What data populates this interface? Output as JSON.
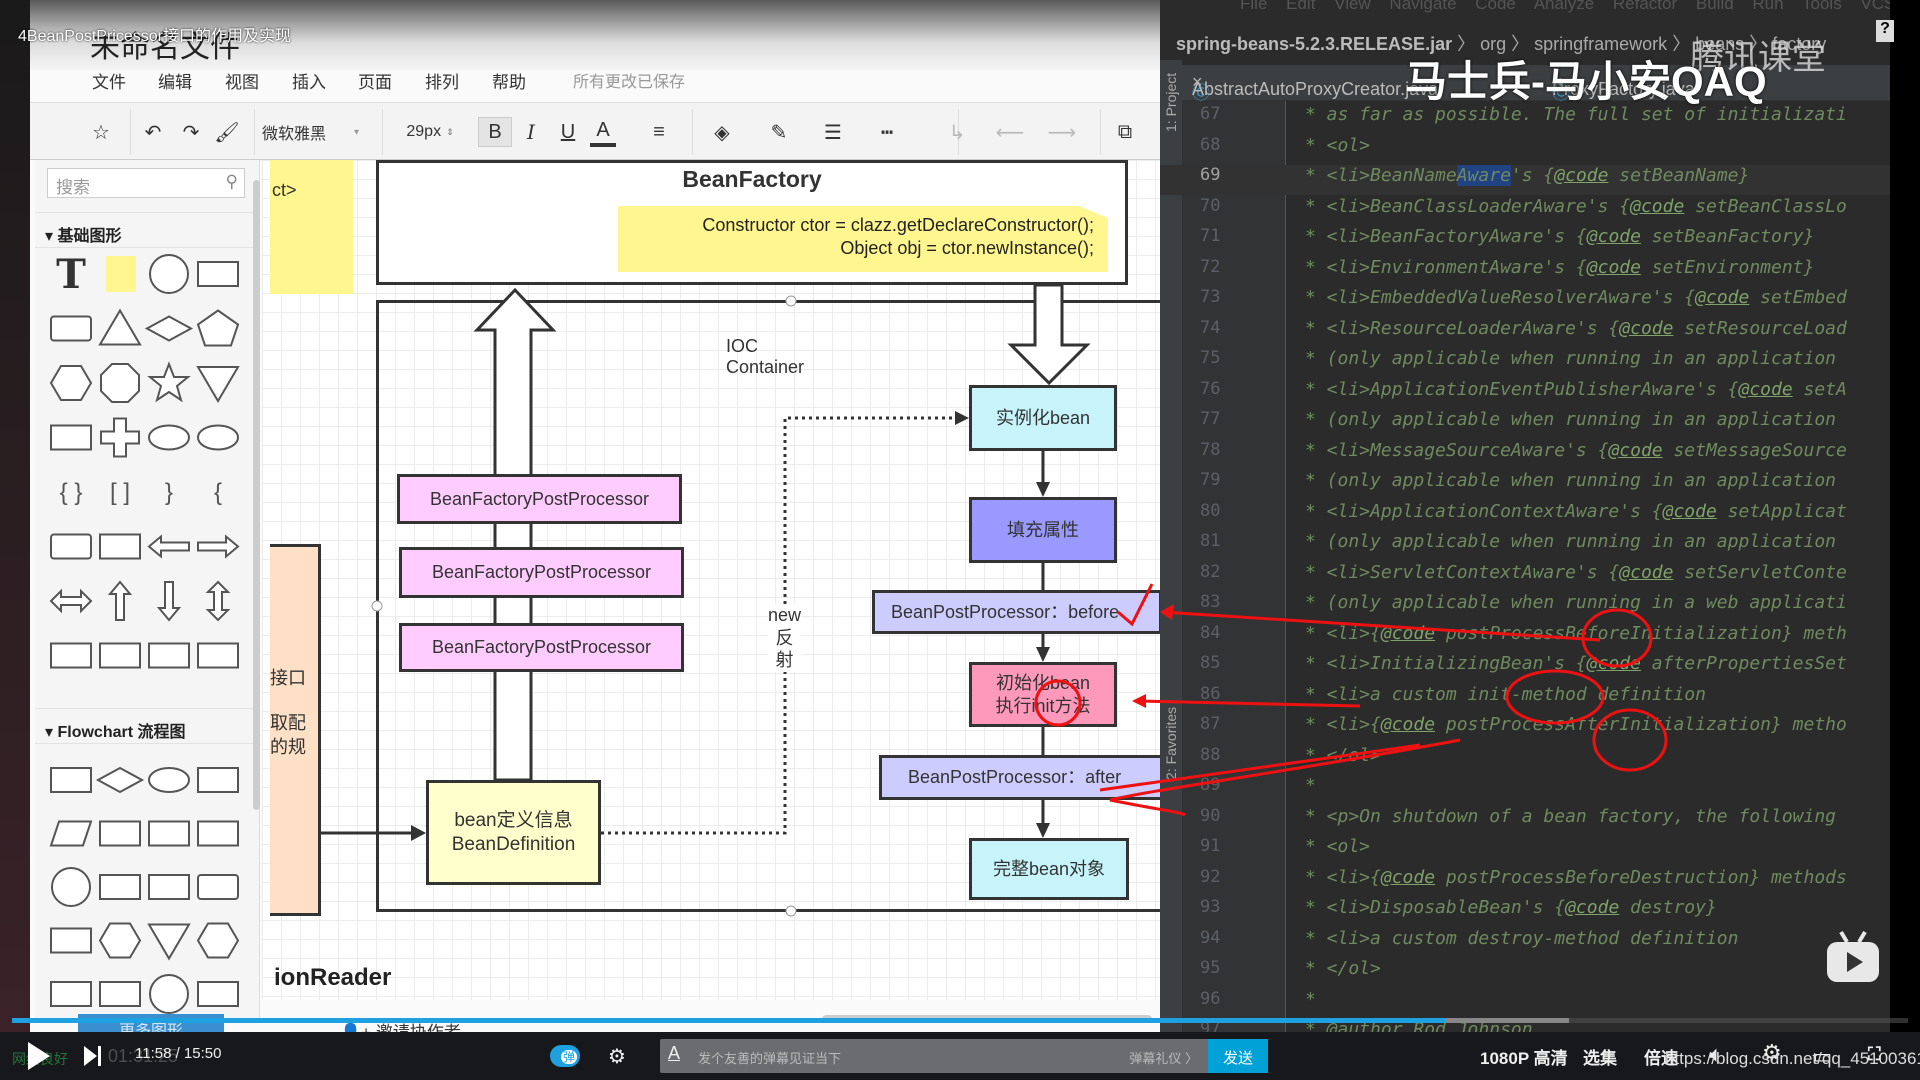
{
  "video": {
    "title": "4BeanPostPricessor接口的作用及实现",
    "watermark": "马士兵-马小安QAQ",
    "platform_mark": "腾讯课堂",
    "csdn_watermark": "https://blog.csdn.net/qq_45100361"
  },
  "editor": {
    "doc_title": "未命名文件",
    "menu": [
      "文件",
      "编辑",
      "视图",
      "插入",
      "页面",
      "排列",
      "帮助"
    ],
    "save_status": "所有更改已保存",
    "toolbar": {
      "font": "微软雅黑",
      "font_size": "29px",
      "bold": "B",
      "italic": "I",
      "underline": "U",
      "font_color": "A"
    },
    "sidebar": {
      "search_placeholder": "搜索",
      "sections": [
        {
          "title": "基础图形",
          "shapes": [
            "text",
            "note",
            "circle",
            "rect",
            "rounded-rect",
            "triangle",
            "diamond",
            "pentagon",
            "hexagon",
            "octagon",
            "star",
            "inverted-triangle",
            "banner",
            "cross",
            "cloud",
            "speech-bubble",
            "braces",
            "brackets",
            "right-brace",
            "left-brace",
            "card",
            "drop",
            "left-arrow",
            "right-arrow",
            "double-arrow",
            "up-arrow",
            "down-arrow",
            "up-down-arrow",
            "u-turn-right",
            "u-turn-left",
            "corner",
            "rect"
          ]
        },
        {
          "title": "Flowchart 流程图",
          "shapes": [
            "process",
            "decision",
            "terminator",
            "document",
            "data",
            "predefined",
            "stored-data",
            "internal-storage",
            "connector",
            "direct-data",
            "manual-input",
            "card",
            "tape",
            "display",
            "manual-operation",
            "preparation",
            "rect",
            "rect",
            "circle",
            "rect"
          ]
        }
      ],
      "more_shapes": "更多图形"
    },
    "invite": "邀请协作者"
  },
  "diagram": {
    "partial_note": "ct>",
    "partial_side": [
      "接口",
      "取配",
      "的规"
    ],
    "partial_bottom": "ionReader",
    "bean_factory": {
      "title": "BeanFactory",
      "code": [
        "Constructor ctor = clazz.getDeclareConstructor();",
        "Object obj = ctor.newInstance();"
      ]
    },
    "ioc_label": "IOC  Container",
    "bfpp": [
      "BeanFactoryPostProcessor",
      "BeanFactoryPostProcessor",
      "BeanFactoryPostProcessor"
    ],
    "bean_definition": [
      "bean定义信息",
      "BeanDefinition"
    ],
    "new_label": [
      "new",
      "反射"
    ],
    "steps": {
      "instantiate": "实例化bean",
      "populate": "填充属性",
      "bpp_before": "BeanPostProcessor：before",
      "init": [
        "初始化bean",
        "执行init方法"
      ],
      "bpp_after": "BeanPostProcessor：after",
      "complete": "完整bean对象"
    },
    "colors": {
      "cyan": "#c6f4fa",
      "purple": "#9999ff",
      "lavender": "#ccccff",
      "pink": "#ff99bb",
      "magenta": "#ffccff",
      "yellow": "#ffffcc",
      "note": "#fff68f",
      "peach": "#fde0c6",
      "annotation": "#ee1111"
    }
  },
  "ide": {
    "menu": [
      "File",
      "Edit",
      "View",
      "Navigate",
      "Code",
      "Analyze",
      "Refactor",
      "Build",
      "Run",
      "Tools",
      "VCS"
    ],
    "breadcrumbs": [
      "spring-beans-5.2.3.RELEASE.jar",
      "org",
      "springframework",
      "beans",
      "factory"
    ],
    "tabs": [
      "AbstractAutoProxyCreator.java",
      "ProxyFactory.java"
    ],
    "tool_windows": [
      "1: Project",
      "2: Favorites"
    ],
    "current_line": 69,
    "lines": [
      {
        "n": 67,
        "t": "* as far as possible. The full set of initializati"
      },
      {
        "n": 68,
        "t": "* <ol>"
      },
      {
        "n": 69,
        "t": "* <li>BeanNameAware's {@code setBeanName}"
      },
      {
        "n": 70,
        "t": "* <li>BeanClassLoaderAware's {@code setBeanClassLo"
      },
      {
        "n": 71,
        "t": "* <li>BeanFactoryAware's {@code setBeanFactory}"
      },
      {
        "n": 72,
        "t": "* <li>EnvironmentAware's {@code setEnvironment}"
      },
      {
        "n": 73,
        "t": "* <li>EmbeddedValueResolverAware's {@code setEmbed"
      },
      {
        "n": 74,
        "t": "* <li>ResourceLoaderAware's {@code setResourceLoad"
      },
      {
        "n": 75,
        "t": "* (only applicable when running in an application"
      },
      {
        "n": 76,
        "t": "* <li>ApplicationEventPublisherAware's {@code setA"
      },
      {
        "n": 77,
        "t": "* (only applicable when running in an application"
      },
      {
        "n": 78,
        "t": "* <li>MessageSourceAware's {@code setMessageSource"
      },
      {
        "n": 79,
        "t": "* (only applicable when running in an application"
      },
      {
        "n": 80,
        "t": "* <li>ApplicationContextAware's {@code setApplicat"
      },
      {
        "n": 81,
        "t": "* (only applicable when running in an application"
      },
      {
        "n": 82,
        "t": "* <li>ServletContextAware's {@code setServletConte"
      },
      {
        "n": 83,
        "t": "* (only applicable when running in a web applicati"
      },
      {
        "n": 84,
        "t": "* <li>{@code postProcessBeforeInitialization} meth"
      },
      {
        "n": 85,
        "t": "* <li>InitializingBean's {@code afterPropertiesSet"
      },
      {
        "n": 86,
        "t": "* <li>a custom init-method definition"
      },
      {
        "n": 87,
        "t": "* <li>{@code postProcessAfterInitialization} metho"
      },
      {
        "n": 88,
        "t": "* </ol>"
      },
      {
        "n": 89,
        "t": "*"
      },
      {
        "n": 90,
        "t": "* <p>On shutdown of a bean factory, the following"
      },
      {
        "n": 91,
        "t": "* <ol>"
      },
      {
        "n": 92,
        "t": "* <li>{@code postProcessBeforeDestruction} methods"
      },
      {
        "n": 93,
        "t": "* <li>DisposableBean's {@code destroy}"
      },
      {
        "n": 94,
        "t": "* <li>a custom destroy-method definition"
      },
      {
        "n": 95,
        "t": "* </ol>"
      },
      {
        "n": 96,
        "t": "*"
      },
      {
        "n": 97,
        "t": "* @author Rod Johnson"
      }
    ]
  },
  "player": {
    "time": "11:58 / 15:50",
    "network": "网络良好",
    "network_time": "01:31:25",
    "progress_percent": 75.6,
    "buffered_percent": 82.1,
    "danmaku_toggle": "弹",
    "danmaku_placeholder": "发个友善的弹幕见证当下",
    "danmaku_etiquette": "弹幕礼仪 〉",
    "send": "发送",
    "quality": "1080P 高清",
    "episodes": "选集",
    "speed": "倍速"
  }
}
